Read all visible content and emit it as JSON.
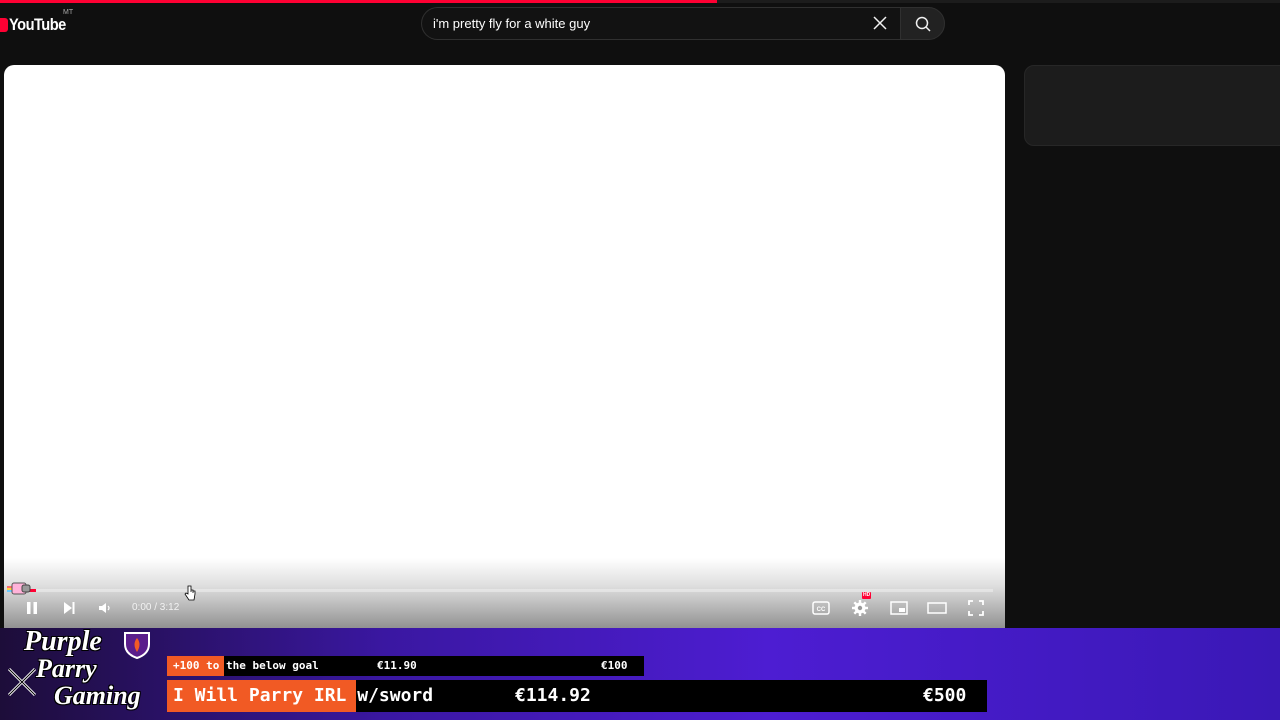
{
  "page_progress": 0.56,
  "header": {
    "logo_text": "YouTube",
    "region_code": "MT",
    "search_query": "i'm pretty fly for a white guy"
  },
  "player": {
    "time": "0:00 / 3:12",
    "watched_fraction": 0.02,
    "hd_badge": "HD",
    "icons": [
      "pause-icon",
      "next-icon",
      "volume-icon",
      "captions-icon",
      "settings-icon",
      "miniplayer-icon",
      "theater-icon",
      "fullscreen-icon"
    ]
  },
  "overlay": {
    "brand": [
      "Purple",
      "Parry",
      "Gaming"
    ],
    "goal1": {
      "label": "+100 to the below goal",
      "current": "€11.90",
      "target": "€100",
      "fill_fraction": 0.119
    },
    "goal2": {
      "label": "I Will Parry IRL w/sword",
      "current": "€114.92",
      "target": "€500",
      "fill_fraction": 0.23
    },
    "colors": {
      "fill": "#f15a24",
      "bar_bg": "#000000",
      "purple": "#4d1dd2"
    }
  }
}
